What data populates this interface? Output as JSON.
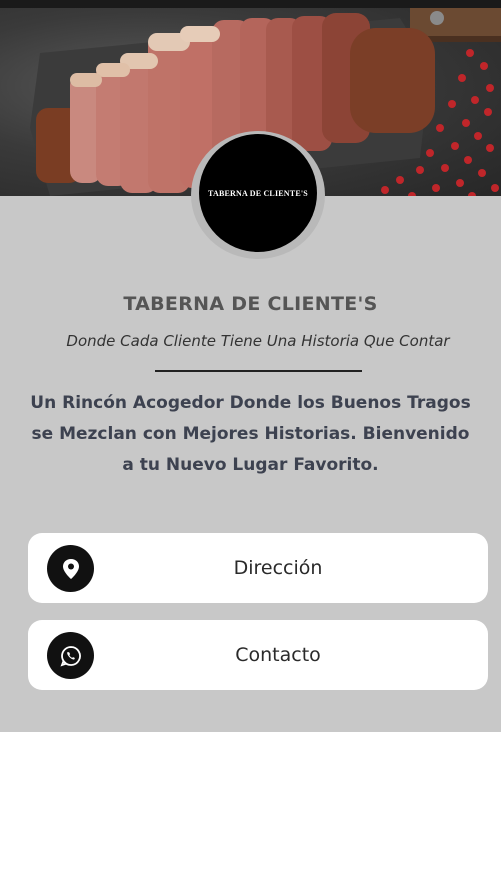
{
  "header": {
    "logo_text": "TABERNA DE CLIENTE'S",
    "hero_image": "steak-hero-image"
  },
  "profile": {
    "title": "TABERNA DE CLIENTE'S",
    "subtitle": "Donde Cada Cliente Tiene Una Historia Que Contar",
    "description": "Un Rincón Acogedor Donde los Buenos Tragos se Mezclan con Mejores Historias. Bienvenido a tu Nuevo Lugar Favorito."
  },
  "links": {
    "direccion": {
      "label": "Dirección",
      "icon": "map-pin-icon"
    },
    "contacto": {
      "label": "Contacto",
      "icon": "whatsapp-icon"
    }
  },
  "colors": {
    "panel_bg": "#c8c8c8",
    "title": "#555555",
    "description": "#3d4250",
    "icon_circle": "#111111",
    "button_bg": "#ffffff"
  }
}
